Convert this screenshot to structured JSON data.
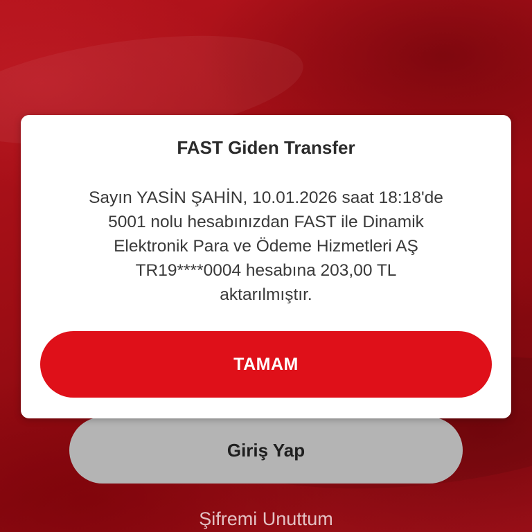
{
  "colors": {
    "background": "#a40f16",
    "primary_button": "#df1019",
    "secondary_button": "#b4b4b4",
    "dialog_background": "#ffffff"
  },
  "login": {
    "button_label": "Giriş Yap",
    "forgot_password_label": "Şifremi Unuttum"
  },
  "dialog": {
    "title": "FAST Giden Transfer",
    "message_lines": [
      "Sayın YASİN ŞAHİN, 10.01.2026 saat 18:18'de",
      "5001 nolu hesabınızdan FAST ile Dinamik",
      "Elektronik Para ve Ödeme Hizmetleri AŞ",
      "TR19****0004 hesabına 203,00 TL",
      "aktarılmıştır."
    ],
    "ok_label": "TAMAM"
  }
}
